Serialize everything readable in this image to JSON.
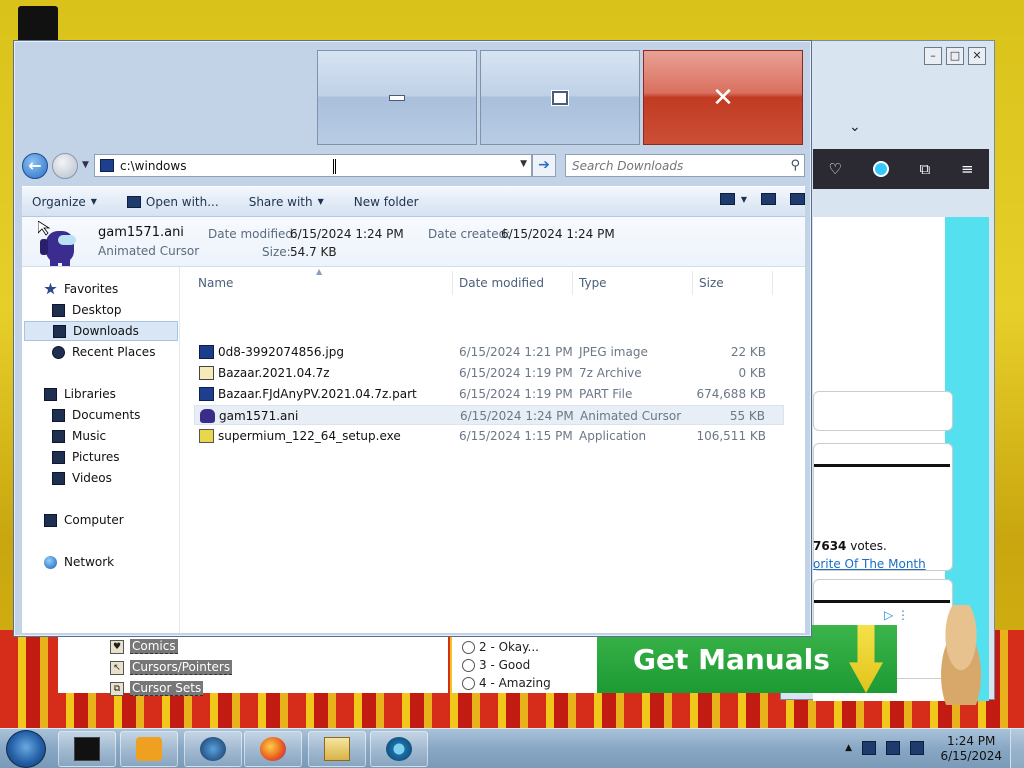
{
  "explorer": {
    "address": "c:\\windows",
    "search_placeholder": "Search Downloads",
    "toolbar": {
      "organize": "Organize",
      "open_with": "Open with...",
      "share_with": "Share with",
      "new_folder": "New folder"
    },
    "details": {
      "name": "gam1571.ani",
      "type": "Animated Cursor",
      "modified_label": "Date modified:",
      "modified_value": "6/15/2024 1:24 PM",
      "created_label": "Date created:",
      "created_value": "6/15/2024 1:24 PM",
      "size_label": "Size:",
      "size_value": "54.7 KB"
    },
    "nav": {
      "favorites": "Favorites",
      "desktop": "Desktop",
      "downloads": "Downloads",
      "recent_places": "Recent Places",
      "libraries": "Libraries",
      "documents": "Documents",
      "music": "Music",
      "pictures": "Pictures",
      "videos": "Videos",
      "computer": "Computer",
      "network": "Network"
    },
    "columns": {
      "name": "Name",
      "date_modified": "Date modified",
      "type": "Type",
      "size": "Size"
    },
    "files": [
      {
        "name": "0d8-3992074856.jpg",
        "date": "6/15/2024 1:21 PM",
        "type": "JPEG image",
        "size": "22 KB",
        "icon": "image-icon"
      },
      {
        "name": "Bazaar.2021.04.7z",
        "date": "6/15/2024 1:19 PM",
        "type": "7z Archive",
        "size": "0 KB",
        "icon": "archive-icon"
      },
      {
        "name": "Bazaar.FJdAnyPV.2021.04.7z.part",
        "date": "6/15/2024 1:19 PM",
        "type": "PART File",
        "size": "674,688 KB",
        "icon": "part-file-icon"
      },
      {
        "name": "gam1571.ani",
        "date": "6/15/2024 1:24 PM",
        "type": "Animated Cursor",
        "size": "55 KB",
        "icon": "cursor-icon"
      },
      {
        "name": "supermium_122_64_setup.exe",
        "date": "6/15/2024 1:15 PM",
        "type": "Application",
        "size": "106,511 KB",
        "icon": "exe-icon"
      }
    ]
  },
  "browser": {
    "votes_count": "7634",
    "votes_suffix": " votes.",
    "favorite_link": "orite Of The Month"
  },
  "site": {
    "links": [
      "Comics",
      "Cursors/Pointers",
      "Cursor Sets"
    ],
    "poll": [
      "2 - Okay...",
      "3 - Good",
      "4 - Amazing"
    ],
    "ad_text": "Get Manuals"
  },
  "taskbar": {
    "time": "1:24 PM",
    "date": "6/15/2024"
  }
}
